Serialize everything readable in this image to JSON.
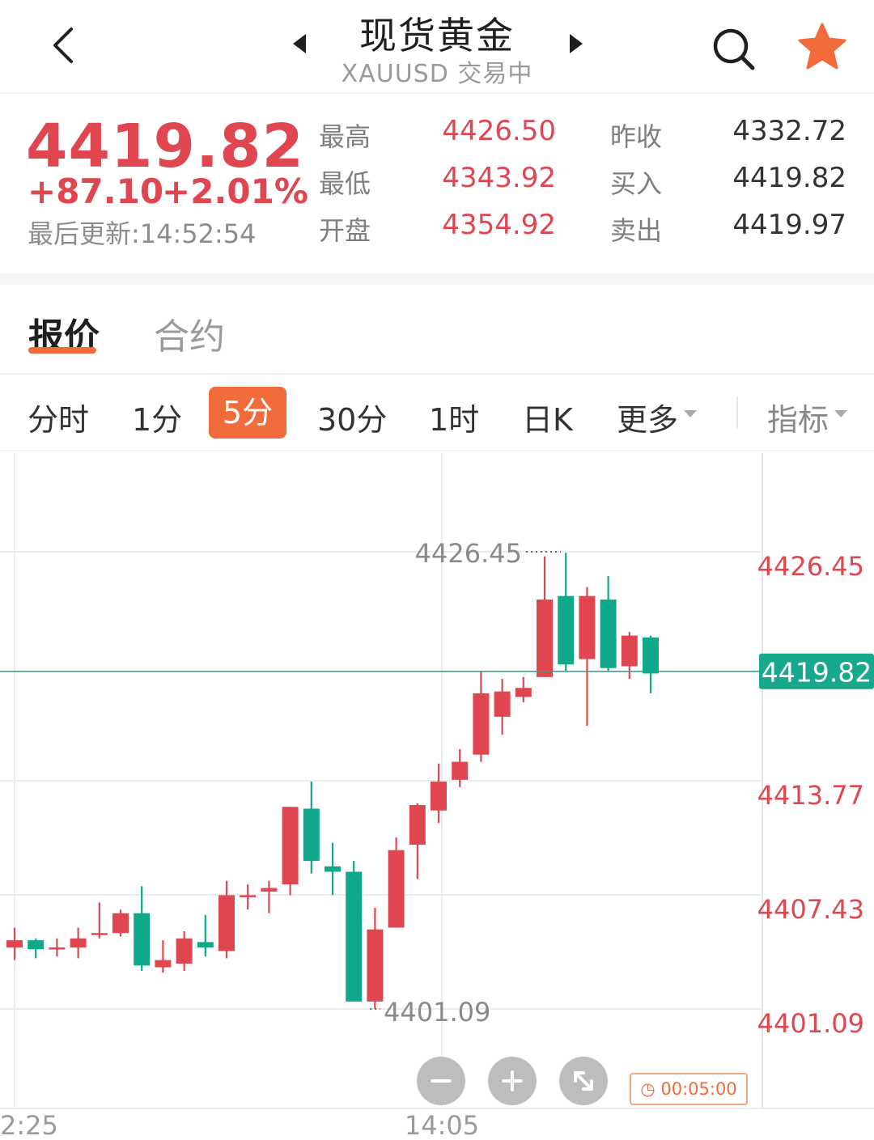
{
  "header": {
    "title": "现货黄金",
    "subtitle": "XAUUSD 交易中",
    "icons": {
      "back": "back-arrow-icon",
      "prev": "prev-symbol-icon",
      "next": "next-symbol-icon",
      "search": "search-icon",
      "favorite": "star-icon"
    }
  },
  "quote": {
    "price": "4419.82",
    "change": "+87.10",
    "change_pct": "+2.01%",
    "updated": "最后更新:14:52:54",
    "stats": [
      {
        "label": "最高",
        "value": "4426.50"
      },
      {
        "label": "最低",
        "value": "4343.92"
      },
      {
        "label": "开盘",
        "value": "4354.92"
      },
      {
        "label": "昨收",
        "value": "4332.72"
      },
      {
        "label": "买入",
        "value": "4419.82"
      },
      {
        "label": "卖出",
        "value": "4419.97"
      }
    ],
    "colors": {
      "up": "#e0464f",
      "down": "#10a88a",
      "accent": "#f26b3a"
    }
  },
  "tabs": [
    {
      "label": "报价",
      "active": true
    },
    {
      "label": "合约",
      "active": false
    }
  ],
  "periods": {
    "items": [
      "分时",
      "1分",
      "5分",
      "30分",
      "1时",
      "日K"
    ],
    "active": "5分",
    "more": "更多",
    "indicators": "指标"
  },
  "chart_data": {
    "type": "candlestick",
    "y_axis_labels": [
      "4426.45",
      "4413.77",
      "4407.43",
      "4401.09"
    ],
    "current_price_label": "4419.82",
    "high_marker": "4426.45",
    "low_marker": "4401.09",
    "x_labels": [
      "2:25",
      "14:05"
    ],
    "interval_label": "00:05:00",
    "candles": [
      {
        "open": 4404.5,
        "close": 4404.9,
        "high": 4405.6,
        "low": 4403.8
      },
      {
        "open": 4404.9,
        "close": 4404.4,
        "high": 4405.0,
        "low": 4403.9
      },
      {
        "open": 4404.5,
        "close": 4404.5,
        "high": 4405.0,
        "low": 4404.0
      },
      {
        "open": 4404.5,
        "close": 4405.0,
        "high": 4405.6,
        "low": 4403.9
      },
      {
        "open": 4405.3,
        "close": 4405.3,
        "high": 4407.0,
        "low": 4405.0
      },
      {
        "open": 4405.3,
        "close": 4406.4,
        "high": 4406.6,
        "low": 4405.1
      },
      {
        "open": 4406.4,
        "close": 4403.5,
        "high": 4407.9,
        "low": 4403.2
      },
      {
        "open": 4403.4,
        "close": 4403.8,
        "high": 4404.9,
        "low": 4403.1
      },
      {
        "open": 4403.6,
        "close": 4405.0,
        "high": 4405.4,
        "low": 4403.2
      },
      {
        "open": 4404.8,
        "close": 4404.5,
        "high": 4406.3,
        "low": 4404.0
      },
      {
        "open": 4404.3,
        "close": 4407.4,
        "high": 4408.2,
        "low": 4403.9
      },
      {
        "open": 4407.3,
        "close": 4407.4,
        "high": 4408.0,
        "low": 4406.6
      },
      {
        "open": 4407.6,
        "close": 4407.8,
        "high": 4408.2,
        "low": 4406.4
      },
      {
        "open": 4408.0,
        "close": 4412.3,
        "high": 4412.3,
        "low": 4407.4
      },
      {
        "open": 4412.2,
        "close": 4409.3,
        "high": 4413.7,
        "low": 4408.6
      },
      {
        "open": 4409.0,
        "close": 4408.7,
        "high": 4410.3,
        "low": 4407.4
      },
      {
        "open": 4408.7,
        "close": 4401.5,
        "high": 4409.3,
        "low": 4401.5
      },
      {
        "open": 4401.5,
        "close": 4405.5,
        "high": 4406.7,
        "low": 4401.1
      },
      {
        "open": 4405.6,
        "close": 4409.9,
        "high": 4410.6,
        "low": 4405.6
      },
      {
        "open": 4410.2,
        "close": 4412.4,
        "high": 4412.5,
        "low": 4408.3
      },
      {
        "open": 4412.1,
        "close": 4413.7,
        "high": 4414.7,
        "low": 4411.4
      },
      {
        "open": 4413.8,
        "close": 4414.8,
        "high": 4415.5,
        "low": 4413.4
      },
      {
        "open": 4415.2,
        "close": 4418.6,
        "high": 4419.8,
        "low": 4414.8
      },
      {
        "open": 4417.3,
        "close": 4418.7,
        "high": 4419.4,
        "low": 4416.3
      },
      {
        "open": 4418.4,
        "close": 4418.9,
        "high": 4419.5,
        "low": 4418.1
      },
      {
        "open": 4419.5,
        "close": 4423.8,
        "high": 4426.2,
        "low": 4419.5
      },
      {
        "open": 4424.0,
        "close": 4420.2,
        "high": 4426.4,
        "low": 4419.8
      },
      {
        "open": 4420.5,
        "close": 4424.0,
        "high": 4424.5,
        "low": 4416.8
      },
      {
        "open": 4423.8,
        "close": 4420.0,
        "high": 4425.1,
        "low": 4419.8
      },
      {
        "open": 4420.1,
        "close": 4421.8,
        "high": 4422.0,
        "low": 4419.4
      },
      {
        "open": 4421.7,
        "close": 4419.7,
        "high": 4421.8,
        "low": 4418.6
      }
    ]
  }
}
